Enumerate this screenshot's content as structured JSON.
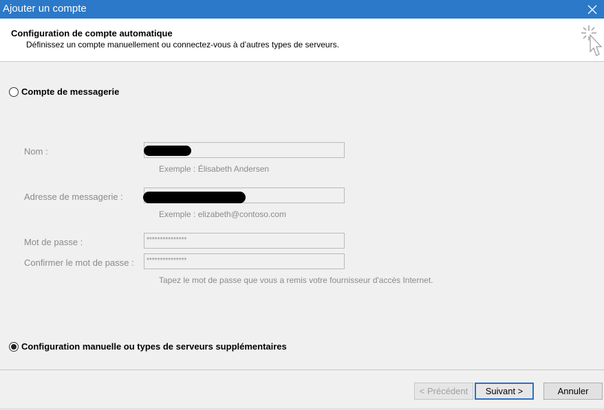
{
  "window": {
    "title": "Ajouter un compte",
    "close_icon": "close-icon"
  },
  "header": {
    "title": "Configuration de compte automatique",
    "subtitle": "Définissez un compte manuellement ou connectez-vous à d’autres types de serveurs.",
    "icon": "wand-cursor-icon"
  },
  "options": {
    "email_account": {
      "label": "Compte de messagerie",
      "selected": false
    },
    "manual_config": {
      "label": "Configuration manuelle ou types de serveurs supplémentaires",
      "selected": true
    }
  },
  "form": {
    "name_label": "Nom :",
    "name_value": "",
    "name_hint": "Exemple : Élisabeth Andersen",
    "email_label": "Adresse de messagerie :",
    "email_value": "",
    "email_hint": "Exemple : elizabeth@contoso.com",
    "password_label": "Mot de passe :",
    "password_value": "***************",
    "confirm_label": "Confirmer le mot de passe :",
    "confirm_value": "***************",
    "password_hint": "Tapez le mot de passe que vous a remis votre fournisseur d'accès Internet."
  },
  "buttons": {
    "previous": "< Précédent",
    "next": "Suivant >",
    "cancel": "Annuler"
  }
}
